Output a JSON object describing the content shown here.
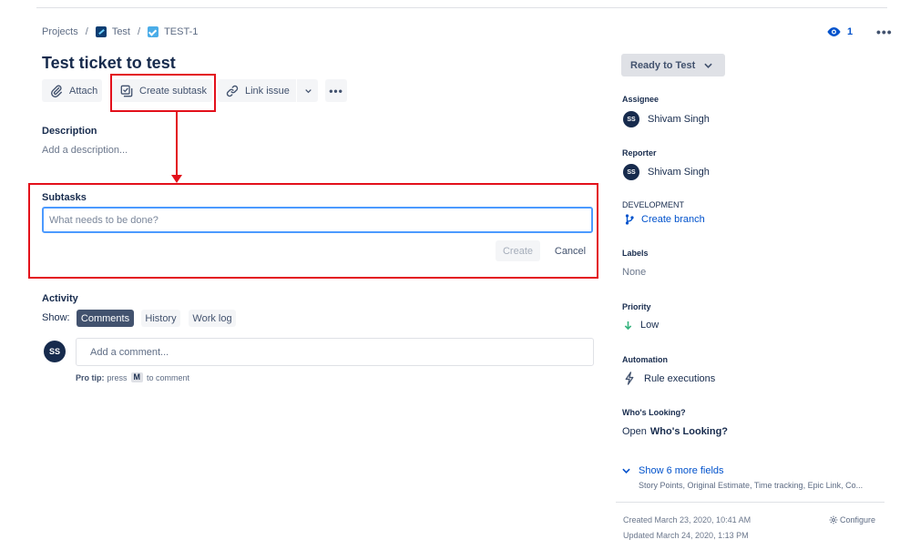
{
  "breadcrumb": {
    "projects": "Projects",
    "separator": "/",
    "project": "Test",
    "issue_key": "TEST-1"
  },
  "watch": {
    "count": "1"
  },
  "issue": {
    "title": "Test ticket to test"
  },
  "actions": {
    "attach": "Attach",
    "create_subtask": "Create subtask",
    "link_issue": "Link issue"
  },
  "description": {
    "label": "Description",
    "placeholder": "Add a description..."
  },
  "subtasks": {
    "label": "Subtasks",
    "input_placeholder": "What needs to be done?",
    "create": "Create",
    "cancel": "Cancel"
  },
  "activity": {
    "label": "Activity",
    "show": "Show:",
    "tabs": [
      "Comments",
      "History",
      "Work log"
    ],
    "active_tab": "Comments",
    "comment_placeholder": "Add a comment...",
    "protip_bold": "Pro tip:",
    "protip_press": "press",
    "protip_key": "M",
    "protip_rest": "to comment",
    "user_initials": "SS"
  },
  "sidebar": {
    "status": "Ready to Test",
    "assignee_label": "Assignee",
    "assignee_name": "Shivam Singh",
    "assignee_initials": "SS",
    "reporter_label": "Reporter",
    "reporter_name": "Shivam Singh",
    "reporter_initials": "SS",
    "development_label": "DEVELOPMENT",
    "create_branch": "Create branch",
    "labels_label": "Labels",
    "labels_value": "None",
    "priority_label": "Priority",
    "priority_value": "Low",
    "automation_label": "Automation",
    "rule_executions": "Rule executions",
    "whos_looking_label": "Who's Looking?",
    "whos_looking_open": "Open",
    "whos_looking_link": "Who's Looking?",
    "show_more": "Show 6 more fields",
    "show_more_sub": "Story Points, Original Estimate, Time tracking, Epic Link, Co...",
    "created": "Created March 23, 2020, 10:41 AM",
    "updated": "Updated March 24, 2020, 1:13 PM",
    "configure": "Configure"
  },
  "colors": {
    "annotation_red": "#e3101b",
    "link_blue": "#0052cc",
    "priority_low_green": "#36b37e"
  }
}
